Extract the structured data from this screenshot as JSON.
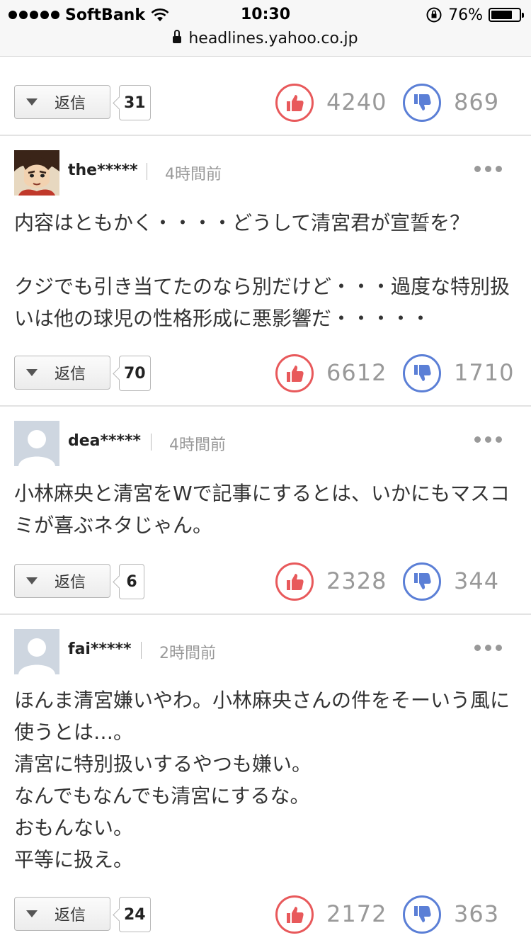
{
  "status_bar": {
    "carrier": "SoftBank",
    "time": "10:30",
    "battery": "76%",
    "battery_level": 0.76,
    "url": "headlines.yahoo.co.jp"
  },
  "reply_label": "返信",
  "top_row": {
    "replies": "31",
    "likes": "4240",
    "dislikes": "869"
  },
  "comments": [
    {
      "user": "the*****",
      "time": "4時間前",
      "text": "内容はともかく・・・・どうして清宮君が宣誓を？\n\nクジでも引き当てたのなら別だけど・・・過度な特別扱いは他の球児の性格形成に悪影響だ・・・・・",
      "replies": "70",
      "likes": "6612",
      "dislikes": "1710"
    },
    {
      "user": "dea*****",
      "time": "4時間前",
      "text": "小林麻央と清宮をWで記事にするとは、いかにもマスコミが喜ぶネタじゃん。",
      "replies": "6",
      "likes": "2328",
      "dislikes": "344"
    },
    {
      "user": "fai*****",
      "time": "2時間前",
      "text": "ほんま清宮嫌いやわ。小林麻央さんの件をそーいう風に使うとは…。\n清宮に特別扱いするやつも嫌い。\nなんでもなんでも清宮にするな。\nおもんない。\n平等に扱え。",
      "replies": "24",
      "likes": "2172",
      "dislikes": "363"
    }
  ],
  "colors": {
    "like": "#e8595b",
    "dislike": "#5b7fd6"
  }
}
